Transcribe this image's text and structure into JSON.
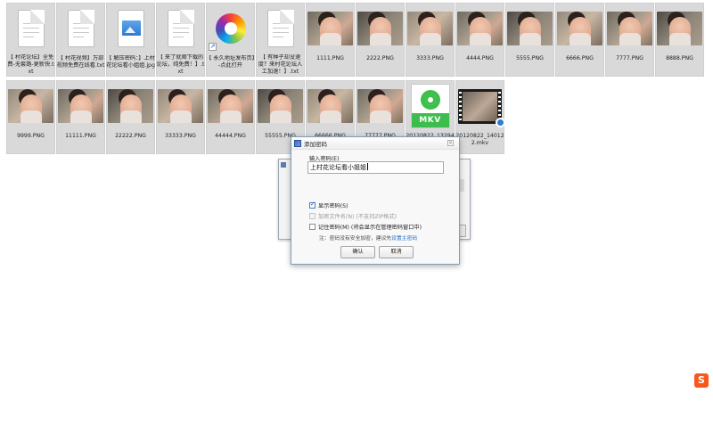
{
  "files": [
    {
      "name": "【 村花论坛】全免费-无套路-更新快.txt",
      "type": "txt"
    },
    {
      "name": "【 村花视频】万部视频免费在线看.txt",
      "type": "txt"
    },
    {
      "name": "【 解压密码：】上村花论坛看小姐姐.jpg",
      "type": "jpg"
    },
    {
      "name": "【 来了就顺下载的论坛，纯免费！】.txt",
      "type": "txt"
    },
    {
      "name": "【 永久地址发布页】-点此打开",
      "type": "shortcut"
    },
    {
      "name": "【 有种子却没速度？来村花论坛人工加速！】.txt",
      "type": "txt"
    },
    {
      "name": "1111.PNG",
      "type": "png"
    },
    {
      "name": "2222.PNG",
      "type": "png"
    },
    {
      "name": "3333.PNG",
      "type": "png"
    },
    {
      "name": "4444.PNG",
      "type": "png"
    },
    {
      "name": "5555.PNG",
      "type": "png"
    },
    {
      "name": "6666.PNG",
      "type": "png"
    },
    {
      "name": "7777.PNG",
      "type": "png"
    },
    {
      "name": "8888.PNG",
      "type": "png"
    },
    {
      "name": "9999.PNG",
      "type": "png"
    },
    {
      "name": "11111.PNG",
      "type": "png"
    },
    {
      "name": "22222.PNG",
      "type": "png"
    },
    {
      "name": "33333.PNG",
      "type": "png"
    },
    {
      "name": "44444.PNG",
      "type": "png"
    },
    {
      "name": "55555.PNG",
      "type": "png"
    },
    {
      "name": "66666.PNG",
      "type": "png"
    },
    {
      "name": "77777.PNG",
      "type": "png"
    },
    {
      "name": "20120822_132943.mkv",
      "type": "mkv"
    },
    {
      "name": "20120822_140122.mkv",
      "type": "video"
    }
  ],
  "dialog": {
    "title": "添加密码",
    "close": "×",
    "input_label": "输入密码(E)",
    "input_value": "上村花论坛看小姐姐",
    "show_password": "显示密码(S)",
    "encrypt_names": "加密文件名(N)",
    "encrypt_names_note": "(不支持ZIP格式)",
    "remember": "记住密码(M)",
    "remember_note": "(将会显示在管理密码窗口中)",
    "note_prefix": "注：密码没有安全加密，建议先",
    "note_link": "设置主密码",
    "ok": "确认",
    "cancel": "取消"
  },
  "tray": {
    "sogou": "S"
  },
  "colors": {
    "accent": "#1a6fc9",
    "dialog_border": "#7f9db9",
    "selection": "#d9d9d9"
  }
}
